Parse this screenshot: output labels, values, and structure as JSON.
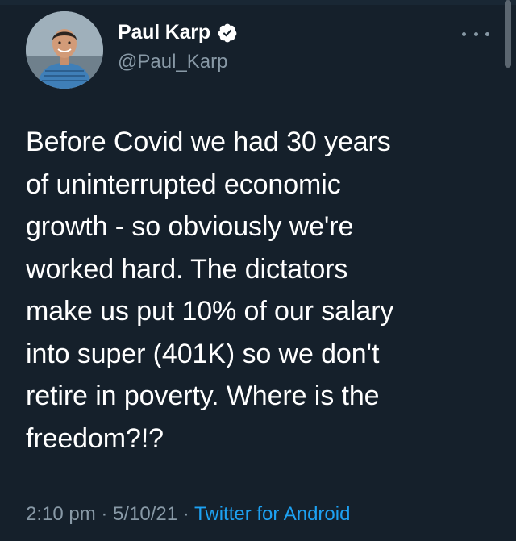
{
  "author": {
    "display_name": "Paul Karp",
    "handle": "@Paul_Karp",
    "verified": true,
    "verified_color": "#1da1f2",
    "avatar_icon": "profile-photo"
  },
  "tweet": {
    "text": "Before Covid we had 30 years\nof uninterrupted economic\ngrowth - so obviously we're\nworked hard. The dictators\nmake us put 10% of our salary\ninto super (401K) so we don't\nretire in poverty. Where is the\nfreedom?!?"
  },
  "meta": {
    "time": "2:10 pm",
    "separator": " · ",
    "date": "5/10/21",
    "source": "Twitter for Android"
  },
  "icons": {
    "more": "more-horizontal-icon",
    "verified": "verified-badge-icon"
  },
  "colors": {
    "background": "#15202b",
    "text": "#ffffff",
    "secondary": "#8899a6",
    "accent": "#1da1f2"
  }
}
